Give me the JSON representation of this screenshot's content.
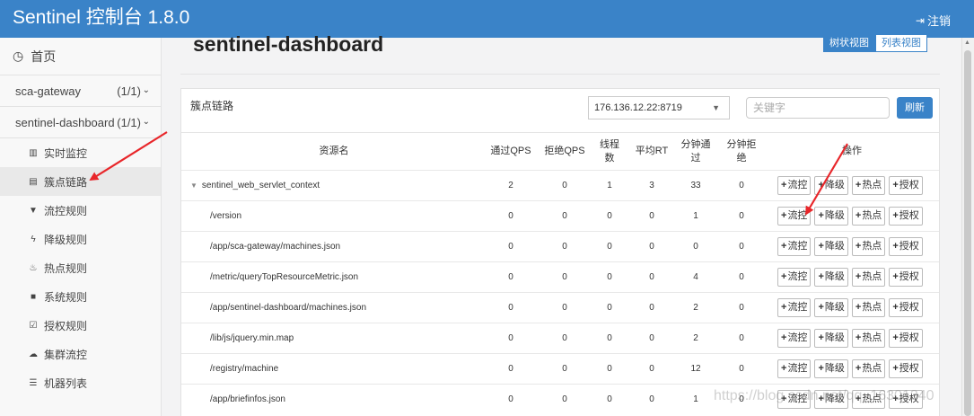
{
  "header": {
    "brand": "Sentinel 控制台 1.8.0",
    "logout_label": "注销"
  },
  "sidebar": {
    "home_label": "首页",
    "apps": [
      {
        "name": "sca-gateway",
        "count": "(1/1)"
      },
      {
        "name": "sentinel-dashboard",
        "count": "(1/1)"
      }
    ],
    "sub_items": [
      {
        "label": "实时监控",
        "icon": "bar-chart-icon",
        "glyph": "▥"
      },
      {
        "label": "簇点链路",
        "icon": "list-icon",
        "glyph": "▤"
      },
      {
        "label": "流控规则",
        "icon": "filter-icon",
        "glyph": "▼"
      },
      {
        "label": "降级规则",
        "icon": "flash-icon",
        "glyph": "ϟ"
      },
      {
        "label": "热点规则",
        "icon": "fire-icon",
        "glyph": "♨"
      },
      {
        "label": "系统规则",
        "icon": "lock-icon",
        "glyph": "■"
      },
      {
        "label": "授权规则",
        "icon": "check-icon",
        "glyph": "☑"
      },
      {
        "label": "集群流控",
        "icon": "cloud-icon",
        "glyph": "☁"
      },
      {
        "label": "机器列表",
        "icon": "th-list-icon",
        "glyph": "☰"
      }
    ],
    "active_index": 1
  },
  "main": {
    "title": "sentinel-dashboard",
    "view_toggle": {
      "tree": "树状视图",
      "list": "列表视图"
    },
    "panel_title": "簇点链路",
    "machine_select": "176.136.12.22:8719",
    "search_placeholder": "关键字",
    "refresh_label": "刷新"
  },
  "table": {
    "headers": {
      "resource": "资源名",
      "pass_qps": "通过QPS",
      "block_qps": "拒绝QPS",
      "threads": "线程数",
      "avg_rt": "平均RT",
      "minute_pass": "分钟通过",
      "minute_block": "分钟拒绝",
      "ops": "操作"
    },
    "op_labels": [
      "流控",
      "降级",
      "热点",
      "授权"
    ],
    "rows": [
      {
        "resource": "sentinel_web_servlet_context",
        "pass_qps": "2",
        "block_qps": "0",
        "threads": "1",
        "avg_rt": "3",
        "minute_pass": "33",
        "minute_block": "0"
      },
      {
        "resource": "/version",
        "pass_qps": "0",
        "block_qps": "0",
        "threads": "0",
        "avg_rt": "0",
        "minute_pass": "1",
        "minute_block": "0"
      },
      {
        "resource": "/app/sca-gateway/machines.json",
        "pass_qps": "0",
        "block_qps": "0",
        "threads": "0",
        "avg_rt": "0",
        "minute_pass": "0",
        "minute_block": "0"
      },
      {
        "resource": "/metric/queryTopResourceMetric.json",
        "pass_qps": "0",
        "block_qps": "0",
        "threads": "0",
        "avg_rt": "0",
        "minute_pass": "4",
        "minute_block": "0"
      },
      {
        "resource": "/app/sentinel-dashboard/machines.json",
        "pass_qps": "0",
        "block_qps": "0",
        "threads": "0",
        "avg_rt": "0",
        "minute_pass": "2",
        "minute_block": "0"
      },
      {
        "resource": "/lib/js/jquery.min.map",
        "pass_qps": "0",
        "block_qps": "0",
        "threads": "0",
        "avg_rt": "0",
        "minute_pass": "2",
        "minute_block": "0"
      },
      {
        "resource": "/registry/machine",
        "pass_qps": "0",
        "block_qps": "0",
        "threads": "0",
        "avg_rt": "0",
        "minute_pass": "12",
        "minute_block": "0"
      },
      {
        "resource": "/app/briefinfos.json",
        "pass_qps": "0",
        "block_qps": "0",
        "threads": "0",
        "avg_rt": "0",
        "minute_pass": "1",
        "minute_block": "0"
      }
    ]
  },
  "watermark": "https://blog.csdn.net/qq_16301340",
  "colors": {
    "primary": "#3a83c8",
    "arrow": "#e8262a"
  }
}
